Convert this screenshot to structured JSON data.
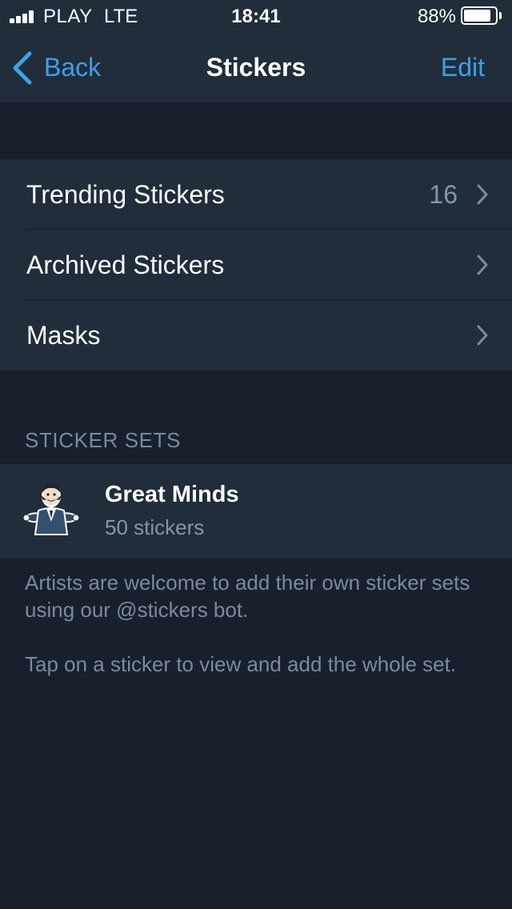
{
  "status_bar": {
    "carrier": "PLAY",
    "network": "LTE",
    "time": "18:41",
    "battery_percent": "88%",
    "battery_level": 0.88,
    "signal_bars_filled": 4,
    "signal_bars_total": 4
  },
  "nav": {
    "back_label": "Back",
    "title": "Stickers",
    "edit_label": "Edit",
    "accent_color": "#3fa0e8"
  },
  "menu": {
    "items": [
      {
        "label": "Trending Stickers",
        "value": "16"
      },
      {
        "label": "Archived Stickers",
        "value": ""
      },
      {
        "label": "Masks",
        "value": ""
      }
    ]
  },
  "sticker_sets": {
    "header": "STICKER SETS",
    "sets": [
      {
        "name": "Great Minds",
        "count": "50 stickers",
        "thumbnail_icon": "caricature-sticker-icon"
      }
    ]
  },
  "footer": {
    "paragraph1": "Artists are welcome to add their own sticker sets using our @stickers bot.",
    "paragraph2": "Tap on a sticker to view and add the whole set."
  },
  "colors": {
    "background": "#18202b",
    "surface": "#212d3b",
    "secondary_text": "#8595a8"
  }
}
